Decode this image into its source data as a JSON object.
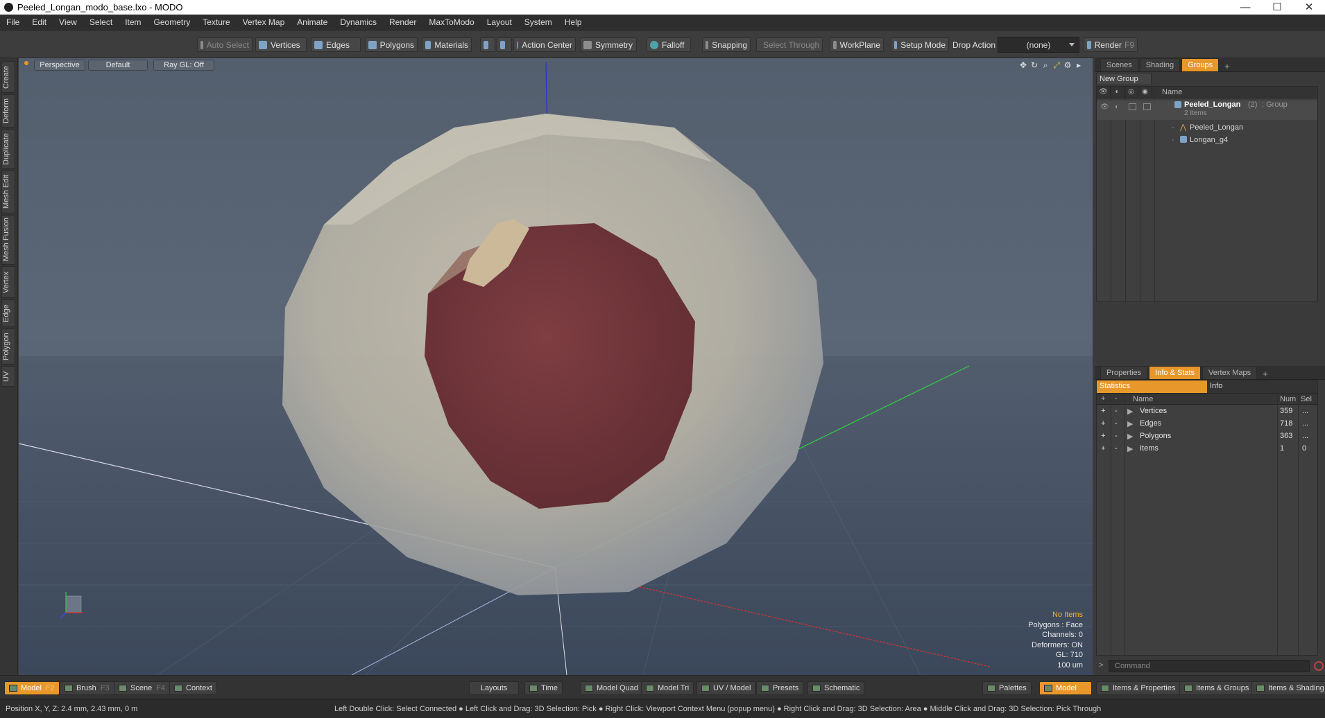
{
  "window": {
    "title": "Peeled_Longan_modo_base.lxo - MODO",
    "minimize": "—",
    "maximize": "☐",
    "close": "✕"
  },
  "menu": [
    "File",
    "Edit",
    "View",
    "Select",
    "Item",
    "Geometry",
    "Texture",
    "Vertex Map",
    "Animate",
    "Dynamics",
    "Render",
    "MaxToModo",
    "Layout",
    "System",
    "Help"
  ],
  "toolbar": {
    "auto_select": "Auto Select",
    "vertices": "Vertices",
    "edges": "Edges",
    "polygons": "Polygons",
    "materials": "Materials",
    "action_center": "Action Center",
    "symmetry": "Symmetry",
    "falloff": "Falloff",
    "snapping": "Snapping",
    "select_through": "Select Through",
    "workplane": "WorkPlane",
    "setup_mode": "Setup Mode",
    "drop_action": "Drop Action",
    "drop_value": "(none)",
    "render": "Render",
    "render_key": "F9"
  },
  "left_tabs": [
    "Create",
    "Deform",
    "Duplicate",
    "Mesh Edit",
    "Mesh Fusion",
    "Vertex",
    "Edge",
    "Polygon",
    "UV"
  ],
  "viewport": {
    "view": "Perspective",
    "shading": "Default",
    "raygl": "Ray GL: Off",
    "overlay": {
      "items": "No Items",
      "polygons": "Polygons : Face",
      "channels": "Channels: 0",
      "deformers": "Deformers: ON",
      "gl": "GL: 710",
      "unit": "100 um"
    }
  },
  "scene_panel": {
    "tabs": [
      "Scenes",
      "Shading",
      "Groups"
    ],
    "active_tab": "Groups",
    "new_group": "New Group",
    "column_name": "Name",
    "group": {
      "name": "Peeled_Longan",
      "count": "(2)",
      "type": ": Group",
      "sub": "2 Items"
    },
    "children": [
      "Peeled_Longan",
      "Longan_g4"
    ]
  },
  "stats_panel": {
    "tabs": [
      "Properties",
      "Info & Stats",
      "Vertex Maps"
    ],
    "sub_tabs": [
      "Statistics",
      "Info"
    ],
    "headers": {
      "name": "Name",
      "num": "Num",
      "sel": "Sel"
    },
    "rows": [
      {
        "name": "Vertices",
        "num": "359",
        "sel": "..."
      },
      {
        "name": "Edges",
        "num": "718",
        "sel": "..."
      },
      {
        "name": "Polygons",
        "num": "363",
        "sel": "..."
      },
      {
        "name": "Items",
        "num": "1",
        "sel": "0"
      }
    ],
    "command_placeholder": "Command"
  },
  "bottom": {
    "model": "Model",
    "model_key": "F2",
    "brush": "Brush",
    "brush_key": "F3",
    "scene": "Scene",
    "scene_key": "F4",
    "context": "Context",
    "layouts": "Layouts",
    "time": "Time",
    "model_quad": "Model Quad",
    "model_tri": "Model Tri",
    "uv_model": "UV / Model",
    "presets": "Presets",
    "schematic": "Schematic",
    "palettes": "Palettes",
    "model_right": "Model",
    "items_properties": "Items & Properties",
    "items_groups": "Items & Groups",
    "items_shading": "Items & Shading"
  },
  "status": {
    "position": "Position X, Y, Z:   2.4 mm, 2.43 mm, 0 m",
    "hint": "Left Double Click: Select Connected ● Left Click and Drag: 3D Selection: Pick ● Right Click: Viewport Context Menu (popup menu) ● Right Click and Drag: 3D Selection: Area ● Middle Click and Drag: 3D Selection: Pick Through"
  },
  "colors": {
    "accent": "#e8982b",
    "viewport_bg": "#5b6777",
    "flesh": "#7a3a3c"
  }
}
